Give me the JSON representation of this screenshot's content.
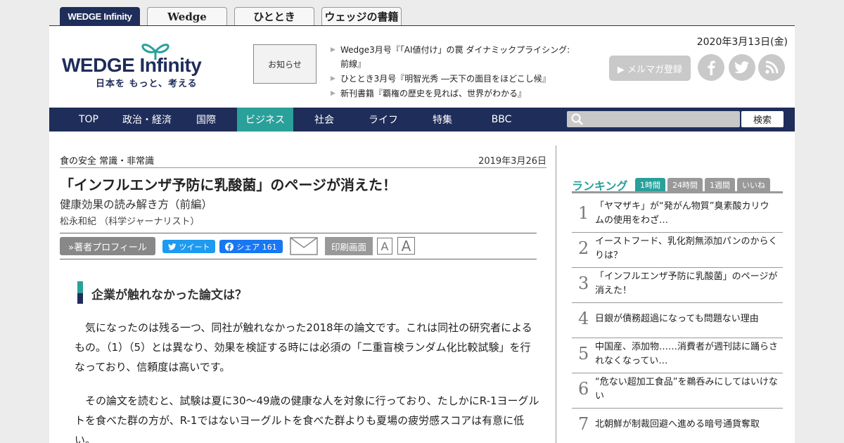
{
  "site_tabs": [
    "WEDGE Infinity",
    "Wedge",
    "ひととき",
    "ウェッジの書籍"
  ],
  "header": {
    "logo_main": "WEDGE Infinity",
    "logo_sub": "日本を もっと、考える",
    "notice_label": "お知らせ",
    "news": [
      "Wedge3月号『「AI値付け」の罠 ダイナミックプライシング: 前線』",
      "ひととき3月号『明智光秀 ―天下の面目をほどこし候』",
      "新刊書籍『覇権の歴史を見れば、世界がわかる』"
    ],
    "date": "2020年3月13日(金)",
    "mailmag_label": "▶ メルマガ登録",
    "social_icons": [
      "facebook-icon",
      "twitter-icon",
      "rss-icon"
    ]
  },
  "nav": {
    "items": [
      "TOP",
      "政治・経済",
      "国際",
      "ビジネス",
      "社会",
      "ライフ",
      "特集",
      "BBC"
    ],
    "active": "ビジネス",
    "search_button": "検索"
  },
  "article": {
    "series": "食の安全 常識・非常識",
    "date": "2019年3月26日",
    "title": "「インフルエンザ予防に乳酸菌」のページが消えた！",
    "subtitle": "健康効果の読み解き方（前編）",
    "author": "松永和紀 （科学ジャーナリスト）",
    "profile_button": "»著者プロフィール",
    "tweet_label": "ツイート",
    "share_label": "シェア 161",
    "print_label": "印刷画面",
    "font_small": "A",
    "font_large": "A",
    "heading": "企業が触れなかった論文は？",
    "paragraph1": "　気になったのは残る一つ、同社が触れなかった2018年の論文です。これは同社の研究者によるもの。（1）（5）とは異なり、効果を検証する時には必須の「二重盲検ランダム化比較試験」を行なっており、信頼度は高いです。",
    "paragraph2": "　その論文を読むと、試験は夏に30〜49歳の健康な人を対象に行っており、たしかにR-1ヨーグルトを食べた群の方が、R-1ではないヨーグルトを食べた群よりも夏場の疲労感スコアは有意に低い。"
  },
  "ranking": {
    "title": "ランキング",
    "tabs": [
      "1時間",
      "24時間",
      "1週間",
      "いいね"
    ],
    "active_tab": "1時間",
    "items": [
      {
        "num": "1",
        "text": "「ヤマザキ」が“発がん物質”臭素酸カリウムの使用をわざ…"
      },
      {
        "num": "2",
        "text": "イーストフード、乳化剤無添加パンのからくりは？"
      },
      {
        "num": "3",
        "text": "「インフルエンザ予防に乳酸菌」のページが消えた！"
      },
      {
        "num": "4",
        "text": "日銀が債務超過になっても問題ない理由"
      },
      {
        "num": "5",
        "text": "中国産、添加物……消費者が週刊誌に踊らされなくなってい…"
      },
      {
        "num": "6",
        "text": "“危ない超加工食品”を鵜呑みにしてはいけない"
      },
      {
        "num": "7",
        "text": "北朝鮮が制裁回避へ進める暗号通貨奪取"
      }
    ]
  },
  "colors": {
    "navy": "#1f2d5a",
    "teal": "#2aa09a"
  }
}
